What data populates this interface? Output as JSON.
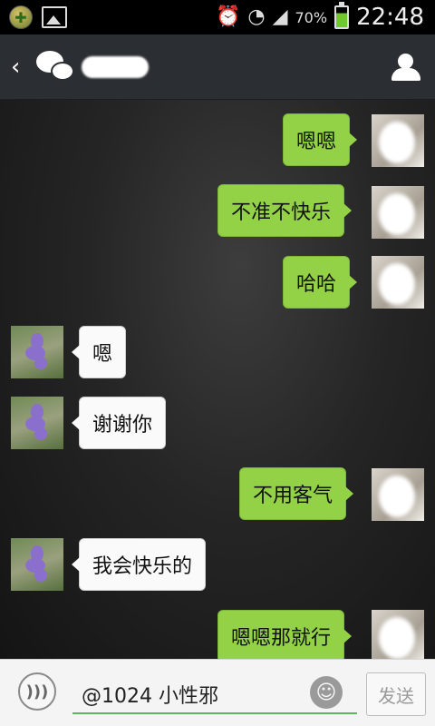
{
  "status_bar": {
    "app_icon": "plus-leaf-icon",
    "gallery_icon": "image-icon",
    "alarm_icon": "alarm-icon",
    "wifi_icon": "wifi-icon",
    "signal_icon": "signal-icon",
    "battery_percent": "70%",
    "battery_icon": "battery-charging-icon",
    "time": "22:48"
  },
  "header": {
    "back_glyph": "‹",
    "logo_icon": "wechat-logo-icon",
    "profile_icon": "person-icon"
  },
  "messages": [
    {
      "side": "out",
      "text": "嗯嗯"
    },
    {
      "side": "out",
      "text": "不准不快乐"
    },
    {
      "side": "out",
      "text": "哈哈"
    },
    {
      "side": "in",
      "text": "嗯"
    },
    {
      "side": "in",
      "text": "谢谢你"
    },
    {
      "side": "out",
      "text": "不用客气"
    },
    {
      "side": "in",
      "text": "我会快乐的"
    },
    {
      "side": "out",
      "text": "嗯嗯那就行"
    }
  ],
  "input_bar": {
    "voice_icon": "voice-icon",
    "input_value": "@1024 小性邪",
    "emoji_icon": "smiley-icon",
    "send_label": "发送"
  },
  "colors": {
    "outgoing_bubble": "#93d147",
    "incoming_bubble": "#fafafa",
    "header_bg": "#2b2e33"
  }
}
